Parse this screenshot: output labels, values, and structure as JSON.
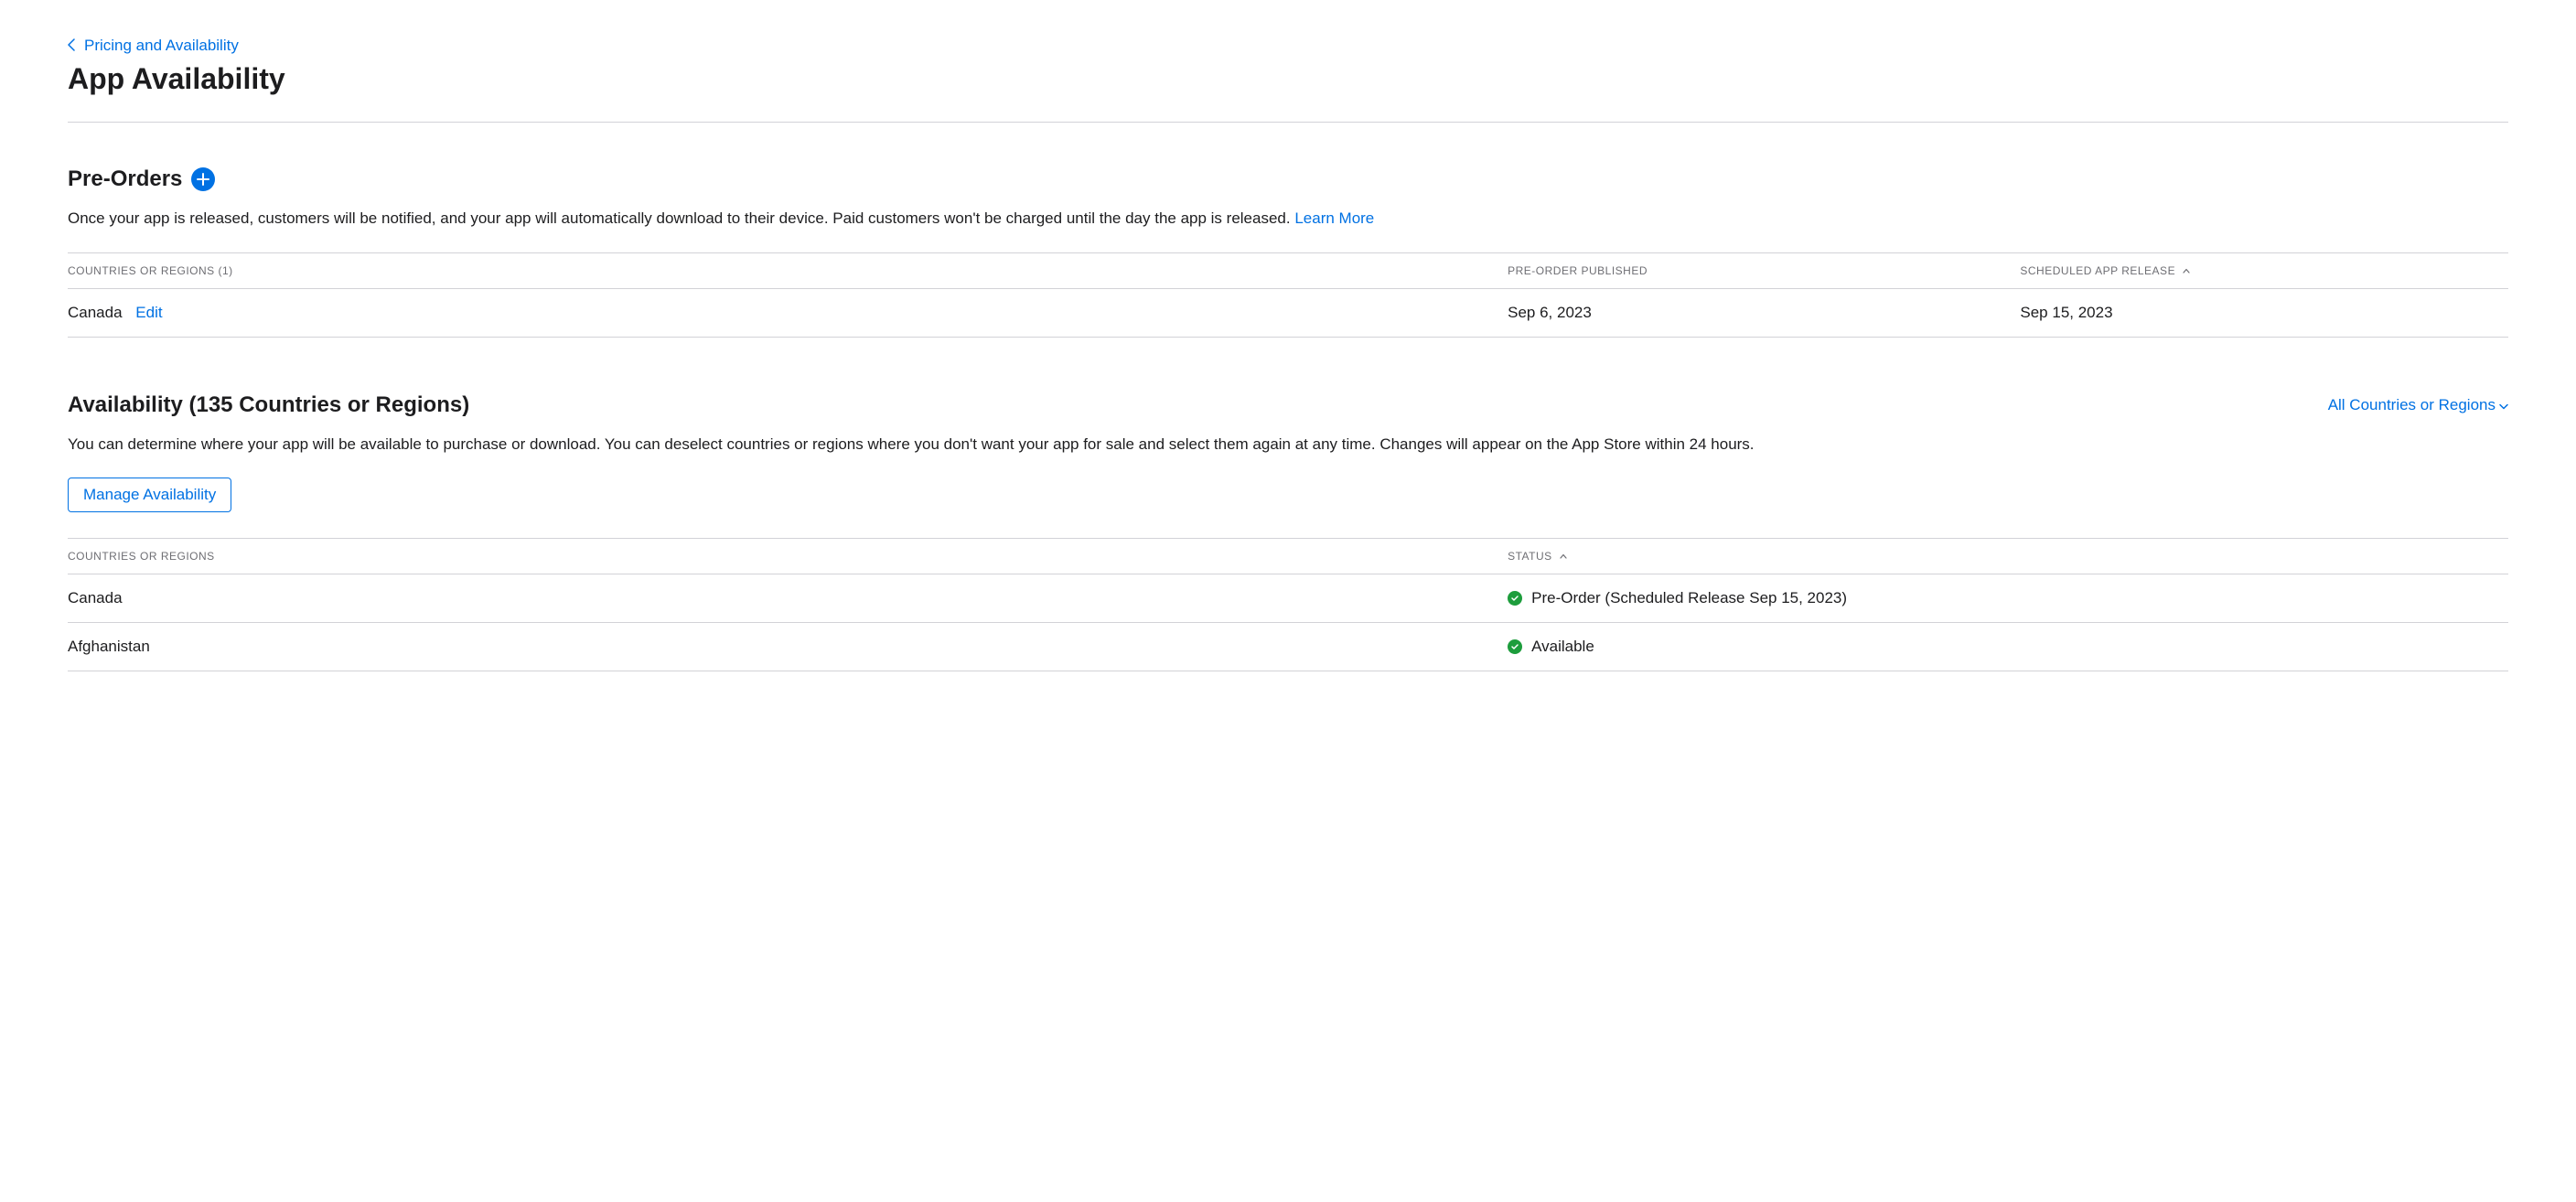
{
  "breadcrumb": {
    "parent": "Pricing and Availability"
  },
  "page_title": "App Availability",
  "preorders": {
    "title": "Pre-Orders",
    "description": "Once your app is released, customers will be notified, and your app will automatically download to their device. Paid customers won't be charged until the day the app is released. ",
    "learn_more": "Learn More",
    "columns": {
      "countries": "COUNTRIES OR REGIONS (1)",
      "published": "PRE-ORDER PUBLISHED",
      "release": "SCHEDULED APP RELEASE"
    },
    "rows": [
      {
        "country": "Canada",
        "edit": "Edit",
        "published": "Sep 6, 2023",
        "release": "Sep 15, 2023"
      }
    ]
  },
  "availability": {
    "title": "Availability (135 Countries or Regions)",
    "filter": "All Countries or Regions",
    "description": "You can determine where your app will be available to purchase or download. You can deselect countries or regions where you don't want your app for sale and select them again at any time. Changes will appear on the App Store within 24 hours.",
    "manage_button": "Manage Availability",
    "columns": {
      "countries": "COUNTRIES OR REGIONS",
      "status": "STATUS"
    },
    "rows": [
      {
        "country": "Canada",
        "status": "Pre-Order (Scheduled Release Sep 15, 2023)"
      },
      {
        "country": "Afghanistan",
        "status": "Available"
      }
    ]
  }
}
